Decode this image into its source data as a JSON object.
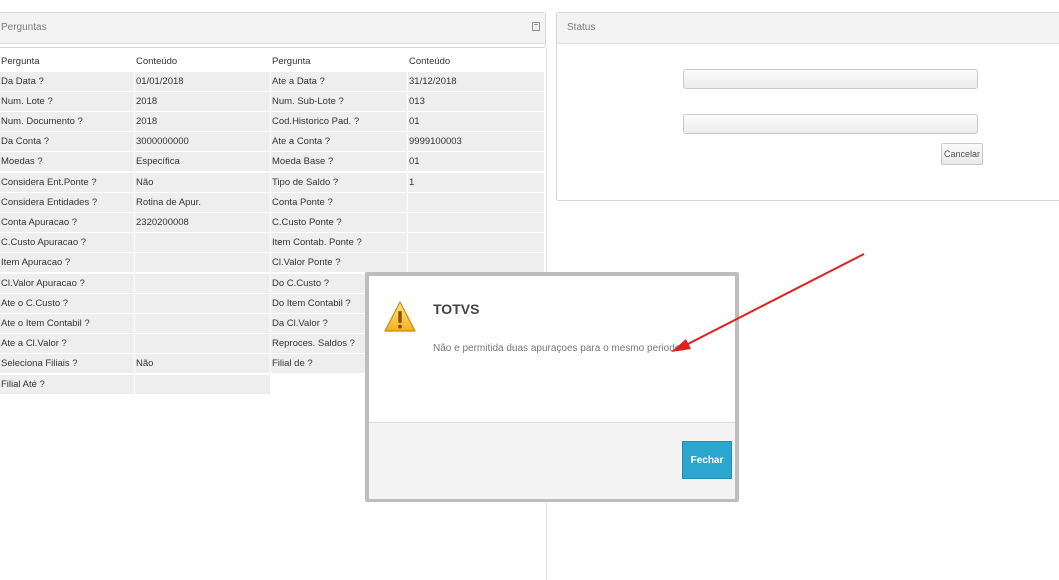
{
  "perguntas_panel": {
    "title": "Perguntas"
  },
  "status_panel": {
    "title": "Status",
    "cancel_label": "Cancelar"
  },
  "table": {
    "headers": [
      "Pergunta",
      "Conteúdo",
      "Pergunta",
      "Conteúdo"
    ],
    "left_rows": [
      {
        "q": "Da Data ?",
        "v": "01/01/2018"
      },
      {
        "q": "Num. Lote ?",
        "v": "2018"
      },
      {
        "q": "Num. Documento ?",
        "v": "2018"
      },
      {
        "q": "Da Conta ?",
        "v": "3000000000"
      },
      {
        "q": "Moedas ?",
        "v": "Específica"
      },
      {
        "q": "Considera Ent.Ponte ?",
        "v": "Não"
      },
      {
        "q": "Considera Entidades ?",
        "v": "Rotina de Apur."
      },
      {
        "q": "Conta Apuracao ?",
        "v": "2320200008"
      },
      {
        "q": "C.Custo Apuracao ?",
        "v": ""
      },
      {
        "q": "Item Apuracao ?",
        "v": ""
      },
      {
        "q": "Cl.Valor Apuracao ?",
        "v": ""
      },
      {
        "q": "Ate o C.Custo ?",
        "v": ""
      },
      {
        "q": "Ate o Item Contabil ?",
        "v": ""
      },
      {
        "q": "Ate a Cl.Valor ?",
        "v": ""
      },
      {
        "q": "Seleciona Filiais ?",
        "v": "Não"
      },
      {
        "q": "Filial Até ?",
        "v": ""
      }
    ],
    "right_rows": [
      {
        "q": "Ate a Data ?",
        "v": "31/12/2018"
      },
      {
        "q": "Num. Sub-Lote ?",
        "v": "013"
      },
      {
        "q": "Cod.Historico Pad. ?",
        "v": "01"
      },
      {
        "q": "Ate a Conta ?",
        "v": "9999100003"
      },
      {
        "q": "Moeda Base ?",
        "v": "01"
      },
      {
        "q": "Tipo de Saldo ?",
        "v": "1"
      },
      {
        "q": "Conta Ponte ?",
        "v": ""
      },
      {
        "q": "C.Custo Ponte ?",
        "v": ""
      },
      {
        "q": "Item Contab. Ponte ?",
        "v": ""
      },
      {
        "q": "Cl.Valor Ponte ?",
        "v": ""
      },
      {
        "q": "Do C.Custo ?",
        "v": ""
      },
      {
        "q": "Do Item Contabil ?",
        "v": ""
      },
      {
        "q": "Da Cl.Valor ?",
        "v": ""
      },
      {
        "q": "Reproces. Saldos ?",
        "v": ""
      },
      {
        "q": "Filial de ?",
        "v": ""
      }
    ]
  },
  "dialog": {
    "title": "TOTVS",
    "message": "Não e permitida duas apuraçoes para o mesmo periodo.",
    "close_label": "Fechar",
    "icon": "warning-icon"
  },
  "annotation": {
    "arrow_color": "#e0201b"
  }
}
